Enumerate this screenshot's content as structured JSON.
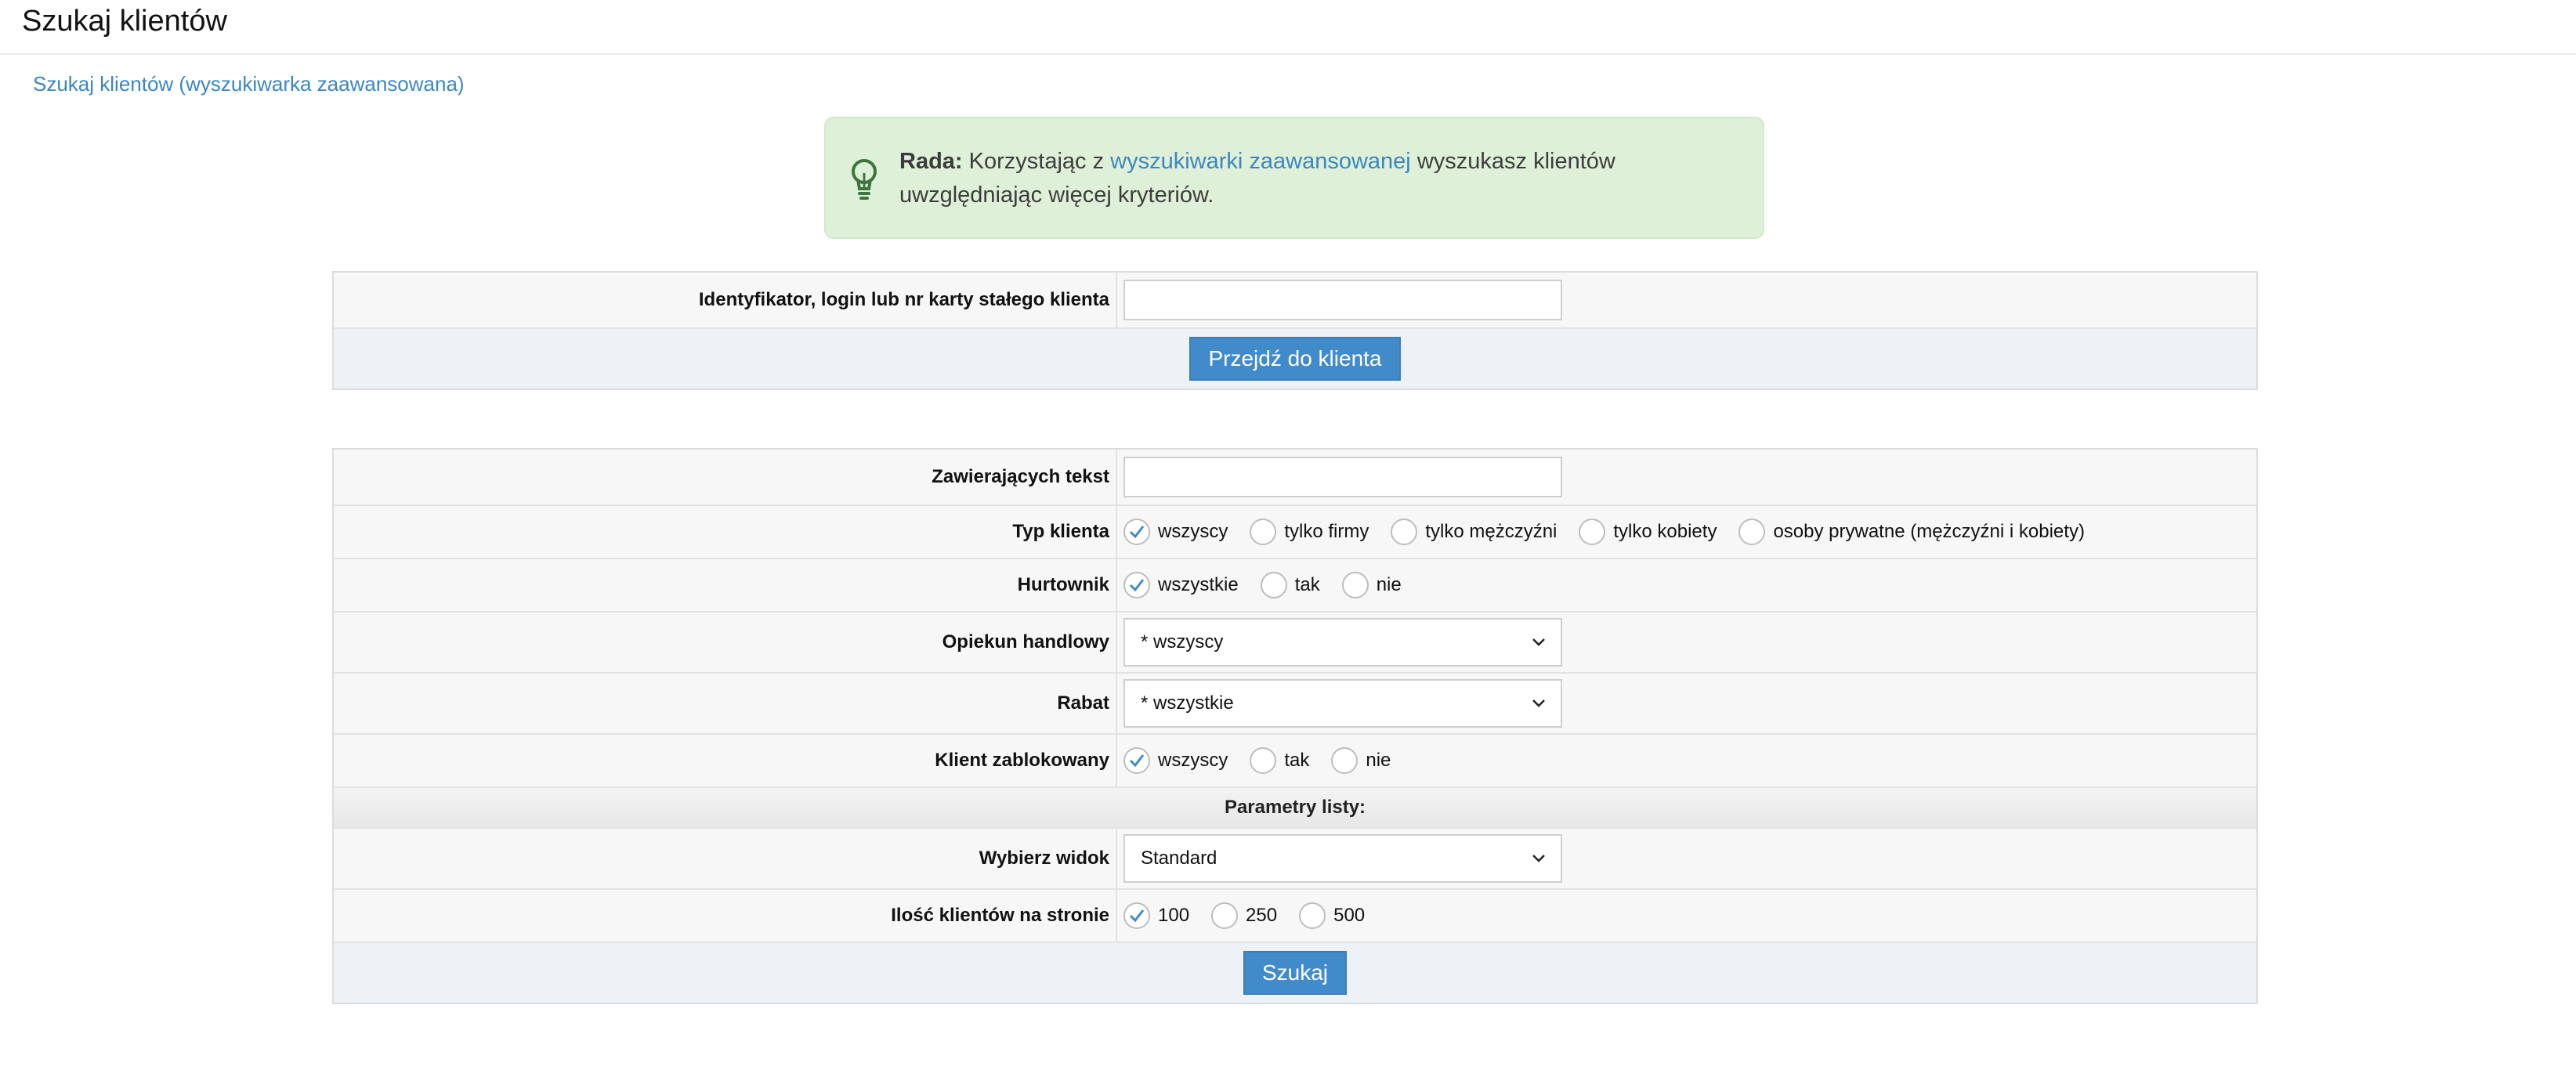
{
  "page": {
    "title": "Szukaj klientów"
  },
  "advanced_link": "Szukaj klientów (wyszukiwarka zaawansowana)",
  "tip": {
    "heading": "Rada:",
    "before_link": "Korzystając z",
    "link_text": "wyszukiwarki zaawansowanej",
    "after_link": "wyszukasz klientów uwzględniając więcej kryteriów."
  },
  "quick_search": {
    "label": "Identyfikator, login lub nr karty stałego klienta",
    "value": "",
    "button": "Przejdź do klienta"
  },
  "search": {
    "text_label": "Zawierających tekst",
    "text_value": "",
    "client_type": {
      "label": "Typ klienta",
      "options": [
        "wszyscy",
        "tylko firmy",
        "tylko mężczyźni",
        "tylko kobiety",
        "osoby prywatne (mężczyźni i kobiety)"
      ],
      "selected": "wszyscy"
    },
    "wholesaler": {
      "label": "Hurtownik",
      "options": [
        "wszystkie",
        "tak",
        "nie"
      ],
      "selected": "wszystkie"
    },
    "account_manager": {
      "label": "Opiekun handlowy",
      "selected": "* wszyscy"
    },
    "discount": {
      "label": "Rabat",
      "selected": "* wszystkie"
    },
    "blocked": {
      "label": "Klient zablokowany",
      "options": [
        "wszyscy",
        "tak",
        "nie"
      ],
      "selected": "wszyscy"
    },
    "list_params_heading": "Parametry listy:",
    "view": {
      "label": "Wybierz widok",
      "selected": "Standard"
    },
    "per_page": {
      "label": "Ilość klientów na stronie",
      "options": [
        "100",
        "250",
        "500"
      ],
      "selected": "100"
    },
    "submit": "Szukaj"
  },
  "colors": {
    "accent": "#428bca",
    "link": "#3a86c4",
    "tip_bg": "#dff0d8",
    "tip_icon": "#3c763d"
  },
  "icons": {
    "tip": "lightbulb-icon",
    "select": "chevron-down-icon",
    "radio_checked": "checkmark-icon"
  }
}
